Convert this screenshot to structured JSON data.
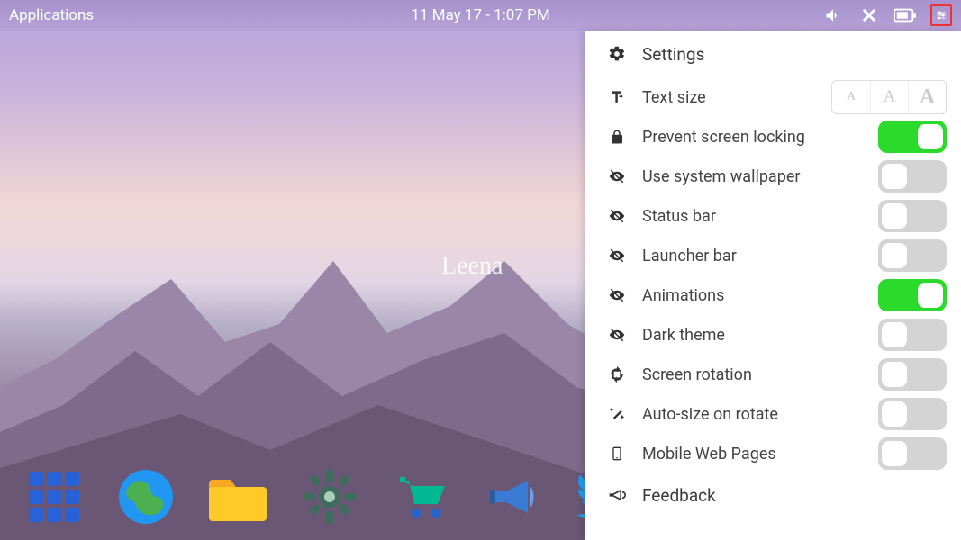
{
  "topbar": {
    "applications_label": "Applications",
    "datetime": "11 May 17 - 1:07 PM"
  },
  "watermark": "Leena",
  "settings": {
    "header_label": "Settings",
    "rows": {
      "text_size": "Text size",
      "prevent_lock": "Prevent screen locking",
      "system_wallpaper": "Use system wallpaper",
      "status_bar": "Status bar",
      "launcher_bar": "Launcher bar",
      "animations": "Animations",
      "dark_theme": "Dark theme",
      "screen_rotation": "Screen rotation",
      "autosize_rotate": "Auto-size on rotate",
      "mobile_web": "Mobile Web Pages"
    },
    "toggles": {
      "prevent_lock": true,
      "system_wallpaper": false,
      "status_bar": false,
      "launcher_bar": false,
      "animations": true,
      "dark_theme": false,
      "screen_rotation": false,
      "autosize_rotate": false,
      "mobile_web": false
    },
    "feedback_label": "Feedback",
    "text_size_options": {
      "small": "A",
      "medium": "A",
      "large": "A"
    }
  }
}
